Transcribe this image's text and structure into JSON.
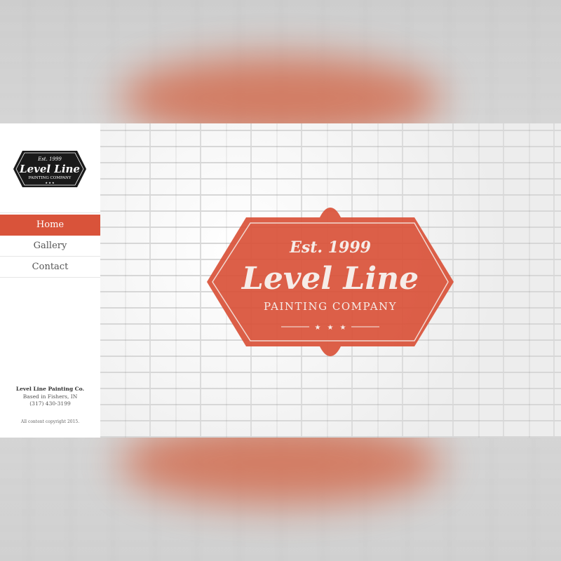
{
  "brand": {
    "est": "Est. 1999",
    "name": "Level Line",
    "tagline": "PAINTING COMPANY",
    "accent": "#d9533a",
    "dark": "#1a1a1a"
  },
  "nav": {
    "items": [
      {
        "label": "Home",
        "active": true
      },
      {
        "label": "Gallery",
        "active": false
      },
      {
        "label": "Contact",
        "active": false
      }
    ]
  },
  "footer": {
    "company": "Level Line Painting Co.",
    "location": "Based in Fishers, IN",
    "phone": "(317) 430-3199",
    "copyright": "All content copyright 2015."
  },
  "icons": [
    "star-icon",
    "star-icon",
    "star-icon"
  ]
}
